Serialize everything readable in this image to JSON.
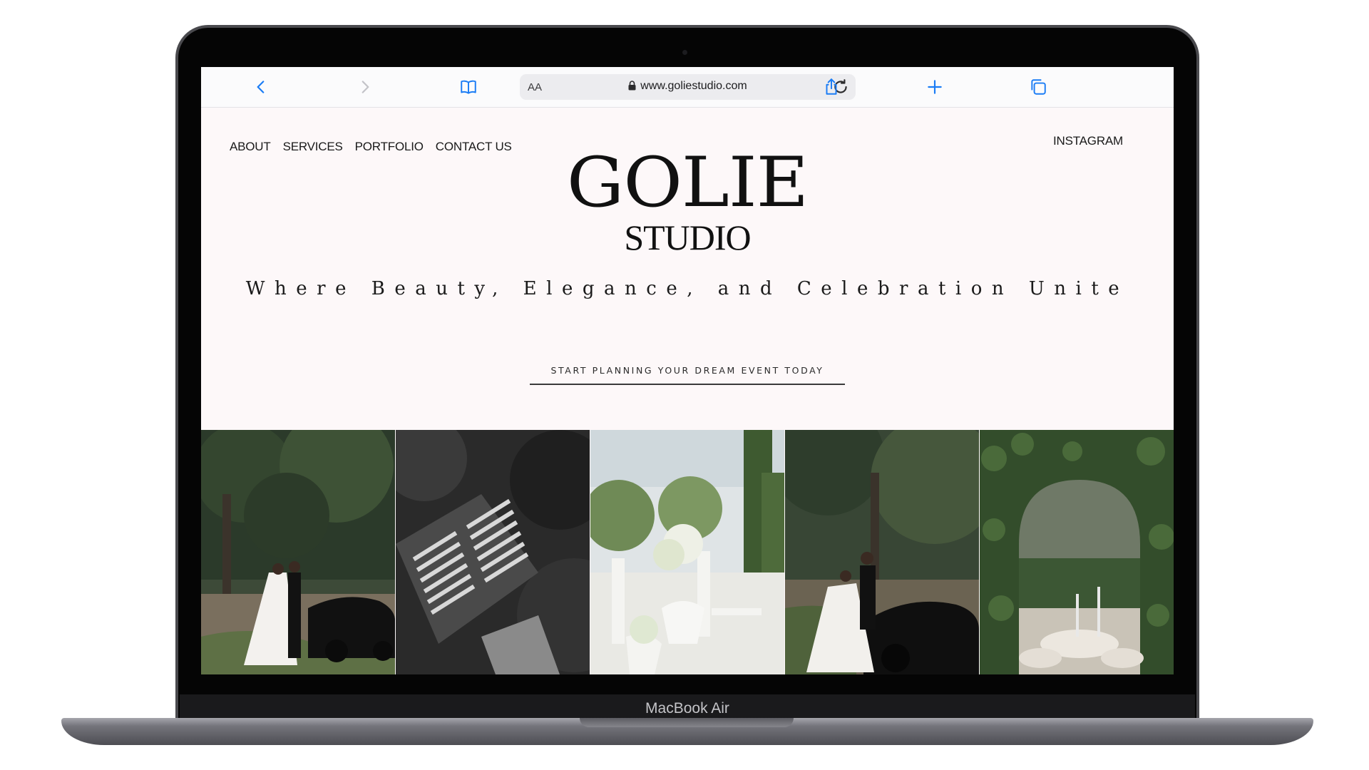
{
  "device": {
    "label": "MacBook Air"
  },
  "browser": {
    "reader_label": "AA",
    "url": "www.goliestudio.com",
    "icons": [
      "chevron-left-icon",
      "chevron-right-icon",
      "book-icon",
      "lock-icon",
      "reload-icon",
      "share-icon",
      "plus-icon",
      "tabs-icon"
    ],
    "accent": "#1a7cf5"
  },
  "site": {
    "nav": [
      "ABOUT",
      "SERVICES",
      "PORTFOLIO",
      "CONTACT US"
    ],
    "instagram": "INSTAGRAM",
    "logo_main": "GOLIE",
    "logo_sub": "STUDIO",
    "tagline": "Where Beauty, Elegance, and Celebration Unite",
    "cta": "START PLANNING YOUR DREAM EVENT TODAY",
    "background": "#fdf8f9"
  },
  "gallery": [
    {
      "subject": "wedding couple kissing by vintage black car under oak trees"
    },
    {
      "subject": "aerial black and white view of ceremony chairs"
    },
    {
      "subject": "white floral garden ceremony with urns and columns"
    },
    {
      "subject": "bride and groom beside vintage black car"
    },
    {
      "subject": "reception tables seen through ivy covered arch"
    }
  ]
}
